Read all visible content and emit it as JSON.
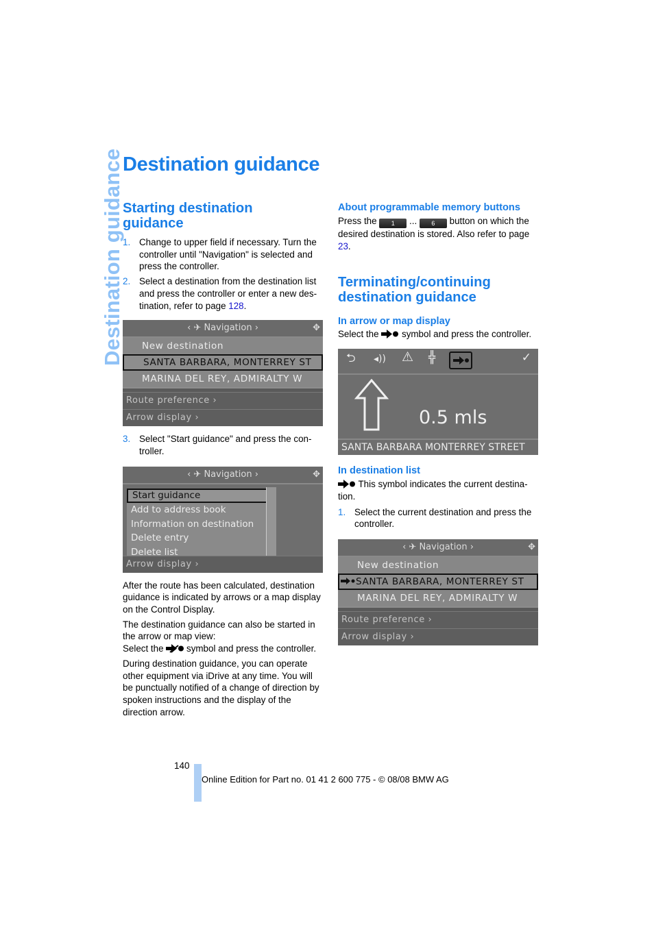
{
  "side_tab": "Destination guidance",
  "title": "Destination guidance",
  "left": {
    "heading": "Starting destination guidance",
    "steps": [
      {
        "num": "1.",
        "text": "Change to upper field if necessary. Turn the controller until \"Navigation\" is selected and press the controller."
      },
      {
        "num": "2.",
        "text_before": "Select a destination from the destination list and press the controller or enter a new des­tination, refer to page ",
        "link": "128",
        "text_after": "."
      }
    ],
    "screen1": {
      "header": "Navigation",
      "rows": [
        "New destination",
        "SANTA BARBARA, MONTERREY ST",
        "MARINA DEL REY, ADMIRALTY W"
      ],
      "selected_index": 1,
      "lower_rows": [
        "Route preference",
        "Arrow display"
      ]
    },
    "step3": {
      "num": "3.",
      "text": "Select \"Start guidance\" and press the con­troller."
    },
    "screen2": {
      "header": "Navigation",
      "menu": [
        "Start guidance",
        "Add to address book",
        "Information on destination",
        "Delete entry",
        "Delete list"
      ],
      "selected_index": 0,
      "lower_row": "Arrow display"
    },
    "para1": "After the route has been calculated, destination guidance is indicated by arrows or a map dis­play on the Control Display.",
    "para2_line1": "The destination guidance can also be started in the arrow or map view:",
    "para2_before": "Select the ",
    "para2_after": " symbol and press the controller.",
    "para3": "During destination guidance, you can operate other equipment via iDrive at any time. You will be punctually notified of a change of direction by spoken instructions and the display of the direction arrow."
  },
  "right": {
    "sub1": "About programmable memory buttons",
    "mem_before": "Press the ",
    "mem_btn1": "1",
    "mem_dots": " ... ",
    "mem_btn6": "6",
    "mem_after": " button on which the desired destination is stored. Also refer to page ",
    "mem_link": "23",
    "mem_end": ".",
    "heading2": "Terminating/continuing destination guidance",
    "sub2": "In arrow or map display",
    "sub2_before": "Select the ",
    "sub2_after": " symbol and press the controller.",
    "screen3": {
      "distance": "0.5 mls",
      "street": "SANTA BARBARA MONTERREY STREET",
      "icons": [
        "back-icon",
        "voice-icon",
        "warning-icon",
        "highway-icon",
        "destination-icon",
        "check-icon"
      ]
    },
    "sub3": "In destination list",
    "symbol_text": " This symbol indicates the current destina­tion.",
    "step1": {
      "num": "1.",
      "text": "Select the current destination and press the controller."
    },
    "screen4": {
      "header": "Navigation",
      "rows": [
        "New destination",
        "SANTA BARBARA, MONTERREY ST",
        "MARINA DEL REY, ADMIRALTY W"
      ],
      "selected_index": 1,
      "lower_rows": [
        "Route preference",
        "Arrow display"
      ]
    }
  },
  "footer": {
    "page_number": "140",
    "text": "Online Edition for Part no. 01 41 2 600 775 - © 08/08 BMW AG"
  }
}
